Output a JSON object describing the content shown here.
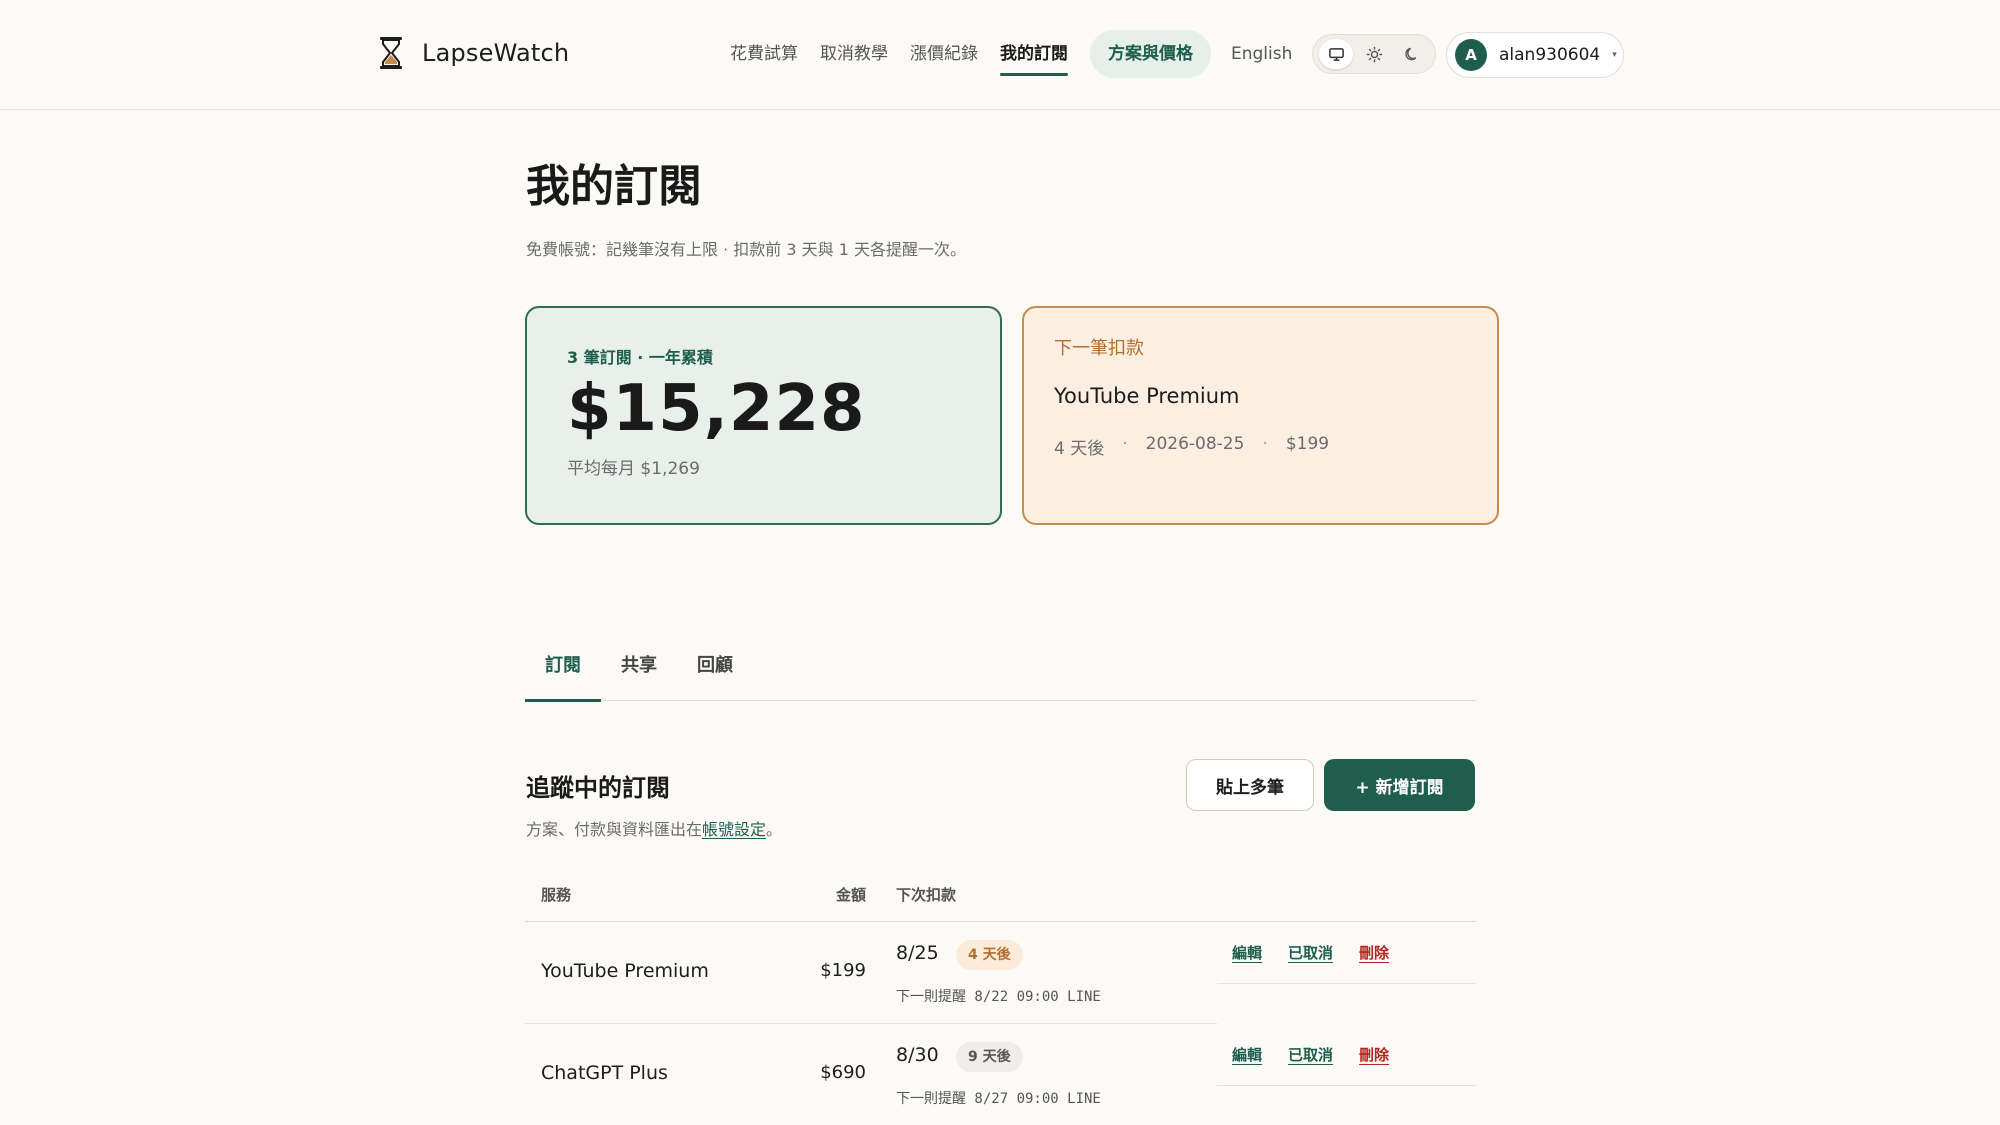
{
  "header": {
    "brand_name": "LapseWatch",
    "nav": [
      "花費試算",
      "取消教學",
      "漲價紀錄",
      "我的訂閱"
    ],
    "nav_active_index": 3,
    "pricing_label": "方案與價格",
    "language_label": "English",
    "theme_options": [
      "monitor-icon",
      "sun-icon",
      "moon-icon"
    ],
    "user": {
      "avatar_initial": "A",
      "name": "alan930604",
      "caret": "▾"
    }
  },
  "page": {
    "title": "我的訂閱",
    "subtitle": "免費帳號：記幾筆沒有上限 · 扣款前 3 天與 1 天各提醒一次。"
  },
  "summary": {
    "total": {
      "eyebrow": "3 筆訂閱 · 一年累積",
      "amount": "$15,228",
      "average": "平均每月 $1,269"
    },
    "next": {
      "eyebrow": "下一筆扣款",
      "service": "YouTube Premium",
      "in_days": "4 天後",
      "date": "2026-08-25",
      "amount": "$199",
      "separator": "·"
    }
  },
  "tabs": [
    "訂閱",
    "共享",
    "回顧"
  ],
  "section": {
    "title": "追蹤中的訂閱",
    "subtitle_prefix": "方案、付款與資料匯出在",
    "subtitle_link": "帳號設定",
    "subtitle_suffix": "。",
    "paste_button": "貼上多筆",
    "add_button": "+ 新增訂閱"
  },
  "table": {
    "headers": {
      "service": "服務",
      "amount": "金額",
      "next": "下次扣款"
    },
    "rows": [
      {
        "service": "YouTube Premium",
        "amount": "$199",
        "date": "8/25",
        "badge": "4 天後",
        "remind": "下一則提醒 8/22 09:00  LINE"
      },
      {
        "service": "ChatGPT Plus",
        "amount": "$690",
        "date": "8/30",
        "badge": "9 天後",
        "remind": "下一則提醒 8/27 09:00  LINE"
      }
    ],
    "actions": {
      "edit": "編輯",
      "cancel": "已取消",
      "delete": "刪除"
    }
  },
  "colors": {
    "accent": "#1f5e4c",
    "warm": "#b06f2f",
    "danger": "#b3261e",
    "background": "#fbfaf7"
  }
}
